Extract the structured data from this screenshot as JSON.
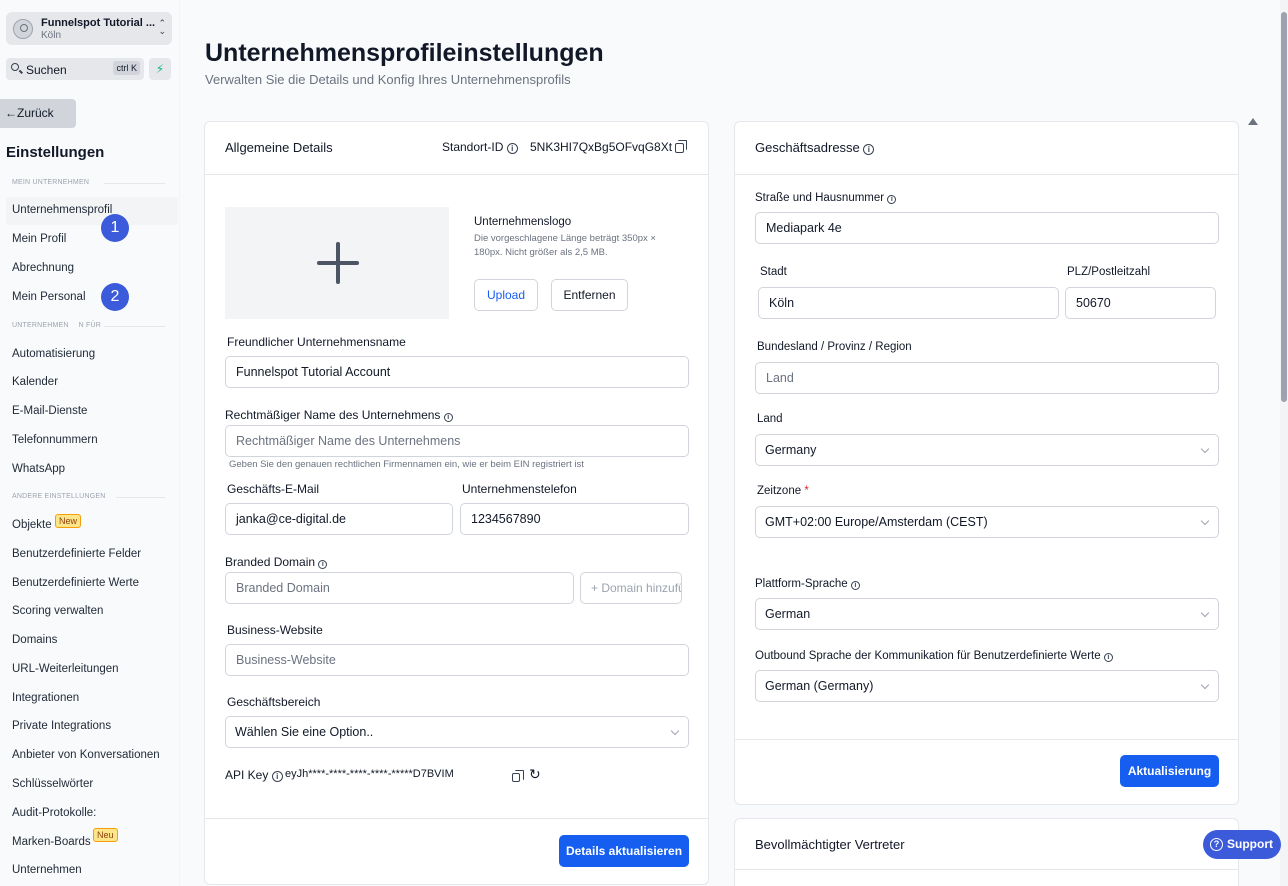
{
  "account": {
    "name": "Funnelspot Tutorial ...",
    "city": "Köln"
  },
  "search": {
    "label": "Suchen",
    "shortcut": "ctrl K"
  },
  "back_label": "Zurück",
  "settings_title": "Einstellungen",
  "sections": {
    "my_company": "MEIN UNTERNEHMEN",
    "company_for": "UNTERNEHMEN",
    "company_for_suffix": "N FÜR",
    "other": "ANDERE EINSTELLUNGEN"
  },
  "nav": {
    "company_profile": "Unternehmensprofil",
    "my_profile": "Mein Profil",
    "billing": "Abrechnung",
    "my_staff": "Mein Personal",
    "automation": "Automatisierung",
    "calendar": "Kalender",
    "email_services": "E-Mail-Dienste",
    "phone_numbers": "Telefonnummern",
    "whatsapp": "WhatsApp",
    "objects": "Objekte",
    "objects_badge": "New",
    "custom_fields": "Benutzerdefinierte Felder",
    "custom_values": "Benutzerdefinierte Werte",
    "scoring": "Scoring verwalten",
    "domains": "Domains",
    "url_redirects": "URL-Weiterleitungen",
    "integrations": "Integrationen",
    "private_integrations": "Private Integrations",
    "conversation_providers": "Anbieter von Konversationen",
    "keywords": "Schlüsselwörter",
    "audit_logs": "Audit-Protokolle:",
    "brand_boards": "Marken-Boards",
    "brand_boards_badge": "Neu",
    "companies": "Unternehmen"
  },
  "steps": [
    "1",
    "2"
  ],
  "page": {
    "title": "Unternehmensprofileinstellungen",
    "subtitle": "Verwalten Sie die Details und Konfig Ihres Unternehmensprofils"
  },
  "general": {
    "title": "Allgemeine Details",
    "location_id_label": "Standort-ID",
    "location_id": "5NK3HI7QxBg5OFvqG8Xt",
    "logo_title": "Unternehmenslogo",
    "logo_hint_1": "Die vorgeschlagene Länge beträgt 350px ×",
    "logo_hint_2": "180px. Nicht größer als 2,5 MB.",
    "upload": "Upload",
    "remove": "Entfernen",
    "friendly_name_label": "Freundlicher Unternehmensname",
    "friendly_name_value": "Funnelspot Tutorial Account",
    "legal_name_label": "Rechtmäßiger Name des Unternehmens",
    "legal_name_placeholder": "Rechtmäßiger Name des Unternehmens",
    "legal_name_hint": "Geben Sie den genauen rechtlichen Firmennamen ein, wie er beim EIN registriert ist",
    "email_label": "Geschäfts-E-Mail",
    "email_value": "janka@ce-digital.de",
    "phone_label": "Unternehmenstelefon",
    "phone_value": "1234567890",
    "domain_label": "Branded Domain",
    "domain_placeholder": "Branded Domain",
    "add_domain": "Domain hinzufügen",
    "website_label": "Business-Website",
    "website_placeholder": "Business-Website",
    "industry_label": "Geschäftsbereich",
    "industry_placeholder": "Wählen Sie eine Option..",
    "api_key_label": "API Key",
    "api_key_value": "eyJh****-****-****-****-*****D7BVIM",
    "update_button": "Details aktualisieren"
  },
  "address": {
    "title": "Geschäftsadresse",
    "street_label": "Straße und Hausnummer",
    "street_value": "Mediapark 4e",
    "city_label": "Stadt",
    "city_value": "Köln",
    "zip_label": "PLZ/Postleitzahl",
    "zip_value": "50670",
    "state_label": "Bundesland / Provinz / Region",
    "state_placeholder": "Land",
    "country_label": "Land",
    "country_value": "Germany",
    "timezone_label": "Zeitzone",
    "timezone_required": "*",
    "timezone_value": "GMT+02:00 Europe/Amsterdam (CEST)",
    "platform_lang_label": "Plattform-Sprache",
    "platform_lang_value": "German",
    "outbound_lang_label": "Outbound Sprache der Kommunikation für Benutzerdefinierte Werte",
    "outbound_lang_value": "German (Germany)",
    "update_button": "Aktualisierung"
  },
  "representative": {
    "title": "Bevollmächtigter Vertreter"
  },
  "support": "Support",
  "colors": {
    "primary": "#155eef",
    "step": "#3b5bdb",
    "badge": "#fde68a",
    "bolt": "#10b981"
  },
  "icons": [
    "user-icon",
    "chevron-updown-icon",
    "search-icon",
    "bolt-icon",
    "arrow-left-icon",
    "info-icon",
    "copy-icon",
    "refresh-icon",
    "plus-icon",
    "chevron-down-icon",
    "help-icon"
  ]
}
